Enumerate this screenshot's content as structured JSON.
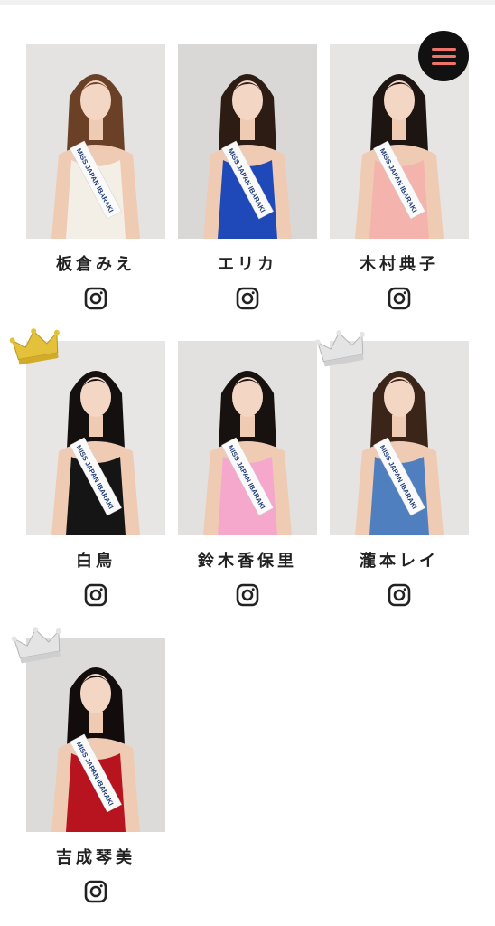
{
  "menu": {
    "icon": "hamburger-menu-icon",
    "bar_color": "#f0746a"
  },
  "sash_text": "MISS JAPAN IBARAKI",
  "instagram_icon": "instagram-icon",
  "crowns": {
    "gold": "#e3c13a",
    "silver": "#d9d9d9"
  },
  "contestants": [
    {
      "name": "板倉みえ",
      "crown": "none",
      "dress_color": "#f3efe6",
      "hair_color": "#6a4127",
      "bg_color": "#e4e3e1"
    },
    {
      "name": "エリカ",
      "crown": "none",
      "dress_color": "#1f49b8",
      "hair_color": "#2d1c14",
      "bg_color": "#d9d8d6"
    },
    {
      "name": "木村典子",
      "crown": "none",
      "dress_color": "#f5b3ad",
      "hair_color": "#1c1512",
      "bg_color": "#e6e5e3"
    },
    {
      "name": "白鳥",
      "crown": "gold",
      "dress_color": "#151515",
      "hair_color": "#141010",
      "bg_color": "#e7e6e4"
    },
    {
      "name": "鈴木香保里",
      "crown": "none",
      "dress_color": "#f6a7cc",
      "hair_color": "#17110f",
      "bg_color": "#e2e1df"
    },
    {
      "name": "瀧本レイ",
      "crown": "silver",
      "dress_color": "#4f7fbf",
      "hair_color": "#3b2518",
      "bg_color": "#e5e4e2"
    },
    {
      "name": "吉成琴美",
      "crown": "silver",
      "dress_color": "#b8141f",
      "hair_color": "#120d0c",
      "bg_color": "#dcdbd9"
    }
  ]
}
